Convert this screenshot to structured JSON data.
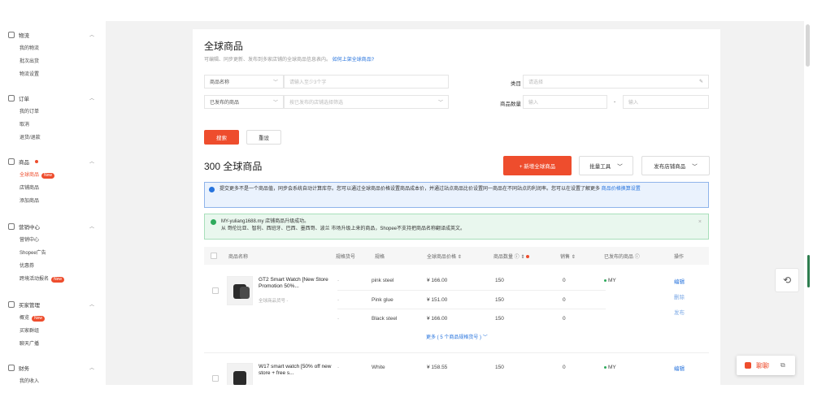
{
  "sidebar": {
    "sections": [
      {
        "label": "物流",
        "items": [
          {
            "label": "我的物流"
          },
          {
            "label": "批次出货"
          },
          {
            "label": "物流设置"
          }
        ]
      },
      {
        "label": "订单",
        "items": [
          {
            "label": "我的订单"
          },
          {
            "label": "取消"
          },
          {
            "label": "退货/退款"
          }
        ]
      },
      {
        "label": "商品",
        "items": [
          {
            "label": "全球商品",
            "badge": "New"
          },
          {
            "label": "店铺商品"
          },
          {
            "label": "添加商品"
          }
        ]
      },
      {
        "label": "营销中心",
        "items": [
          {
            "label": "营销中心"
          },
          {
            "label": "Shopee广告"
          },
          {
            "label": "优惠券"
          },
          {
            "label": "跨境活动报名",
            "badge": "New"
          }
        ]
      },
      {
        "label": "买家管理",
        "items": [
          {
            "label": "概览",
            "badge": "New"
          },
          {
            "label": "买家群组"
          },
          {
            "label": "聊天广播"
          }
        ]
      },
      {
        "label": "财务",
        "items": [
          {
            "label": "我的收入"
          }
        ]
      }
    ]
  },
  "page": {
    "title": "全球商品",
    "subtitle": "可编辑、同步更新、发布到多家店铺的全球商品信息表内。",
    "subtitle_link": "如何上架全球商品?"
  },
  "filters": {
    "name_select": "商品名称",
    "name_placeholder": "请输入至少3个字",
    "status_select": "已发布的商品",
    "status_placeholder": "按已发布的店铺选择筛选",
    "category_label": "类目",
    "category_placeholder": "请选择",
    "stock_label": "商品数量",
    "stock_min_placeholder": "输入",
    "stock_dash": "-",
    "stock_max_placeholder": "输入",
    "search_button": "搜索",
    "reset_button": "重设"
  },
  "toolbar": {
    "count_title": "300 全球商品",
    "add_button": "+ 新增全球商品",
    "bulk_button": "批量工具",
    "publish_button": "发布店铺商品"
  },
  "notices": {
    "info_text": "提交更多不是一个商品值，同步会系统自动计算库存。您可以通过全球商品价格设置商品成本价，并通过站点商品比价设置同一商品在不同站点的利润率。您可以在设置了解更多",
    "info_link": "商品价格换算设置",
    "success_line1": "MY-yuliang1688.my 店铺商品升级成功。",
    "success_line2": "从 哥伦比亚、智利、西班牙、巴西、墨西哥、波兰 市场升级上来的商品，Shopee不支持把商品名称翻译成英文。",
    "close": "×"
  },
  "table": {
    "headers": [
      "商品名称",
      "规格货号",
      "规格",
      "全球商品价格",
      "商品数量",
      "销售",
      "已发布的商品",
      "操作"
    ],
    "products": [
      {
        "name": "GT2 Smart Watch [New Store Promotion 50%...",
        "sku": "全球商品货号 -",
        "variants": [
          {
            "sku": "-",
            "spec": "pink steel",
            "price": "¥ 166.00",
            "qty": "150",
            "sales": "0"
          },
          {
            "sku": "-",
            "spec": "Pink glue",
            "price": "¥ 151.00",
            "qty": "150",
            "sales": "0"
          },
          {
            "sku": "-",
            "spec": "Black steel",
            "price": "¥ 166.00",
            "qty": "150",
            "sales": "0"
          }
        ],
        "published": "MY",
        "actions": [
          "编辑",
          "删除",
          "发布"
        ],
        "more": "更多 ( 5 个商品规格货号 )"
      },
      {
        "name": "W17 smart watch [50% off new store + free s...",
        "variants": [
          {
            "sku": "-",
            "spec": "White",
            "price": "¥ 158.55",
            "qty": "150",
            "sales": "0"
          }
        ],
        "published": "MY",
        "actions": [
          "编辑"
        ]
      }
    ]
  },
  "floating": {
    "chat_label": "聊聊"
  },
  "colors": {
    "brand": "#ee4d2d",
    "link": "#2673dd",
    "success": "#2eaa5c"
  }
}
